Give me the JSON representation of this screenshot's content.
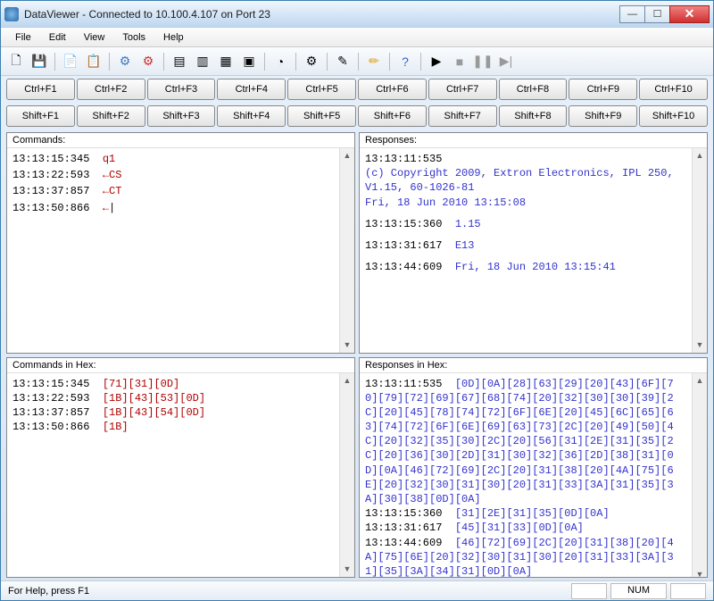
{
  "window": {
    "title": "DataViewer - Connected to 10.100.4.107 on Port 23"
  },
  "menu": {
    "file": "File",
    "edit": "Edit",
    "view": "View",
    "tools": "Tools",
    "help": "Help"
  },
  "shortcuts": {
    "ctrl": [
      "Ctrl+F1",
      "Ctrl+F2",
      "Ctrl+F3",
      "Ctrl+F4",
      "Ctrl+F5",
      "Ctrl+F6",
      "Ctrl+F7",
      "Ctrl+F8",
      "Ctrl+F9",
      "Ctrl+F10"
    ],
    "shift": [
      "Shift+F1",
      "Shift+F2",
      "Shift+F3",
      "Shift+F4",
      "Shift+F5",
      "Shift+F6",
      "Shift+F7",
      "Shift+F8",
      "Shift+F9",
      "Shift+F10"
    ]
  },
  "panes": {
    "commands": {
      "title": "Commands:",
      "rows": [
        {
          "ts": "13:13:15:345",
          "text": "q1"
        },
        {
          "ts": "13:13:22:593",
          "text": "←CS"
        },
        {
          "ts": "13:13:37:857",
          "text": "←CT"
        },
        {
          "ts": "13:13:50:866",
          "text": "←",
          "cursor": "|"
        }
      ]
    },
    "responses": {
      "title": "Responses:",
      "blocks": [
        {
          "ts": "13:13:11:535",
          "lines": [
            "(c) Copyright 2009, Extron Electronics, IPL 250, V1.15, 60-1026-81",
            "Fri, 18 Jun 2010 13:15:08"
          ]
        },
        {
          "ts": "13:13:15:360",
          "lines": [
            "1.15"
          ]
        },
        {
          "ts": "13:13:31:617",
          "lines": [
            "E13"
          ]
        },
        {
          "ts": "13:13:44:609",
          "lines": [
            "Fri, 18 Jun 2010 13:15:41"
          ]
        }
      ]
    },
    "commandsHex": {
      "title": "Commands in Hex:",
      "rows": [
        {
          "ts": "13:13:15:345",
          "hex": "[71][31][0D]"
        },
        {
          "ts": "13:13:22:593",
          "hex": "[1B][43][53][0D]"
        },
        {
          "ts": "13:13:37:857",
          "hex": "[1B][43][54][0D]"
        },
        {
          "ts": "13:13:50:866",
          "hex": "[1B]"
        }
      ]
    },
    "responsesHex": {
      "title": "Responses in Hex:",
      "rows": [
        {
          "ts": "13:13:11:535",
          "hex": "[0D][0A][28][63][29][20][43][6F][70][79][72][69][67][68][74][20][32][30][30][39][2C][20][45][78][74][72][6F][6E][20][45][6C][65][63][74][72][6F][6E][69][63][73][2C][20][49][50][4C][20][32][35][30][2C][20][56][31][2E][31][35][2C][20][36][30][2D][31][30][32][36][2D][38][31][0D][0A][46][72][69][2C][20][31][38][20][4A][75][6E][20][32][30][31][30][20][31][33][3A][31][35][3A][30][38][0D][0A]"
        },
        {
          "ts": "13:13:15:360",
          "hex": "[31][2E][31][35][0D][0A]"
        },
        {
          "ts": "13:13:31:617",
          "hex": "[45][31][33][0D][0A]"
        },
        {
          "ts": "13:13:44:609",
          "hex": "[46][72][69][2C][20][31][38][20][4A][75][6E][20][32][30][31][30][20][31][33][3A][31][35][3A][34][31][0D][0A]"
        }
      ]
    }
  },
  "status": {
    "help": "For Help, press F1",
    "num": "NUM"
  },
  "icons": {
    "new": "new-file-icon",
    "save": "save-icon",
    "copy": "copy-icon",
    "paste": "paste-icon",
    "connect": "connect-icon",
    "disconnect": "disconnect-icon",
    "grid1": "columns-icon",
    "grid2": "columns-alt-icon",
    "list": "list-icon",
    "detail": "grid-icon",
    "clock": "clock-icon",
    "gear": "gear-icon",
    "edit": "edit-icon",
    "pencil": "pencil-icon",
    "help": "help-icon",
    "play": "play-icon",
    "stop": "stop-icon",
    "pause": "pause-icon",
    "next": "next-icon"
  }
}
